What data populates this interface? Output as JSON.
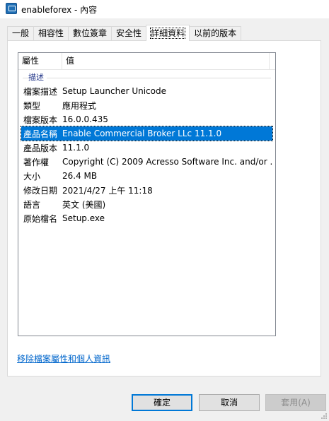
{
  "window": {
    "title": "enableforex - 內容"
  },
  "tabs": [
    {
      "label": "一般"
    },
    {
      "label": "相容性"
    },
    {
      "label": "數位簽章"
    },
    {
      "label": "安全性"
    },
    {
      "label": "詳細資料"
    },
    {
      "label": "以前的版本"
    }
  ],
  "details": {
    "header": {
      "property": "屬性",
      "value": "值"
    },
    "group": "描述",
    "rows": [
      {
        "key": "檔案描述",
        "value": "Setup Launcher Unicode"
      },
      {
        "key": "類型",
        "value": "應用程式"
      },
      {
        "key": "檔案版本",
        "value": "16.0.0.435"
      },
      {
        "key": "產品名稱",
        "value": "Enable Commercial Broker LLc 11.1.0",
        "selected": true
      },
      {
        "key": "產品版本",
        "value": "11.1.0"
      },
      {
        "key": "著作權",
        "value": "Copyright (C) 2009 Acresso Software Inc. and/or ..."
      },
      {
        "key": "大小",
        "value": "26.4 MB"
      },
      {
        "key": "修改日期",
        "value": "2021/4/27 上午 11:18"
      },
      {
        "key": "語言",
        "value": "英文 (美國)"
      },
      {
        "key": "原始檔名",
        "value": "Setup.exe"
      }
    ],
    "remove_link": "移除檔案屬性和個人資訊"
  },
  "buttons": {
    "ok": "確定",
    "cancel": "取消",
    "apply": "套用(A)"
  },
  "colors": {
    "selection": "#0078d7",
    "link": "#0066cc",
    "group_label": "#1e3287"
  }
}
